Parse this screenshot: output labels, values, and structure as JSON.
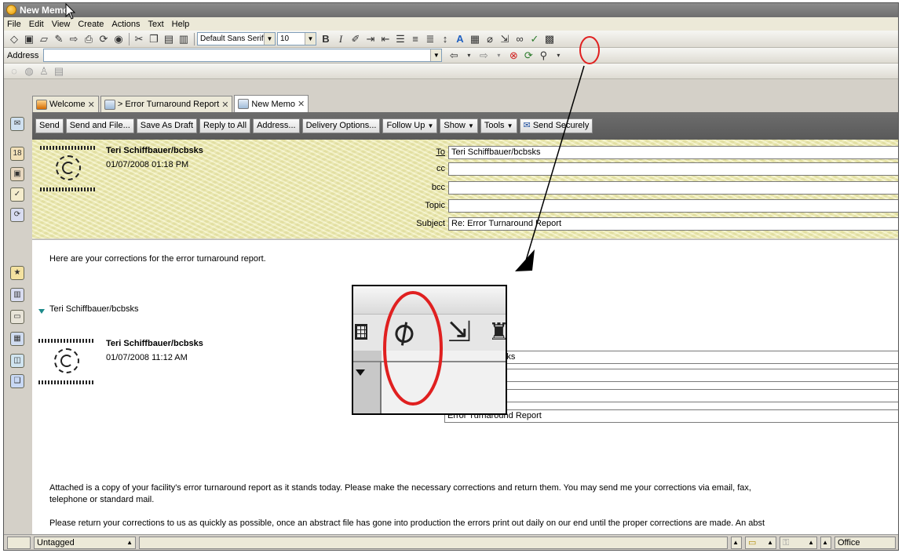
{
  "window": {
    "title": "New Memo"
  },
  "menu": [
    "File",
    "Edit",
    "View",
    "Create",
    "Actions",
    "Text",
    "Help"
  ],
  "format_toolbar": {
    "font": "Default Sans Serif",
    "size": "10"
  },
  "address_bar": {
    "label": "Address",
    "value": ""
  },
  "tabs": [
    {
      "label": "Welcome",
      "icon": "home-icon"
    },
    {
      "label": "> Error Turnaround Report",
      "icon": "document-icon"
    },
    {
      "label": "New Memo",
      "icon": "document-icon"
    }
  ],
  "actions": [
    "Send",
    "Send and File...",
    "Save As Draft",
    "Reply to All",
    "Address...",
    "Delivery Options...",
    "Follow Up",
    "Show",
    "Tools",
    "Send Securely"
  ],
  "header": {
    "sender": "Teri Schiffbauer/bcbsks",
    "date": "01/07/2008 01:18 PM",
    "fields": [
      {
        "label": "To",
        "value": "Teri Schiffbauer/bcbsks"
      },
      {
        "label": "cc",
        "value": ""
      },
      {
        "label": "bcc",
        "value": ""
      },
      {
        "label": "Topic",
        "value": ""
      },
      {
        "label": "Subject",
        "value": "Re: Error Turnaround Report"
      }
    ]
  },
  "body": {
    "intro": "Here are your corrections for the error turnaround report.",
    "thread_sender": "Teri Schiffbauer/bcbsks",
    "quoted": {
      "sender": "Teri Schiffbauer/bcbsks",
      "date": "01/07/2008 11:12 AM",
      "to_partial": "r/bcbsks@bcbsks",
      "subject_partial": "Error Turnaround Report"
    },
    "paragraph1_line1": "Attached is a copy of your facility's error turnaround report as it stands today.  Please make the necessary corrections and return them.  You may send me your corrections via email, fax,",
    "paragraph1_line2": "telephone or standard mail.",
    "paragraph2": "Please return your corrections to us as quickly as possible, once an abstract file has gone into production the errors print out daily on our end until the proper corrections are made.  An abst"
  },
  "status": {
    "tag": "Untagged",
    "location": "Office"
  },
  "colors": {
    "header_bg": "#ebe8a8",
    "action_bar": "#616161",
    "highlight": "#e02020",
    "twistie": "#1d8a8a"
  }
}
